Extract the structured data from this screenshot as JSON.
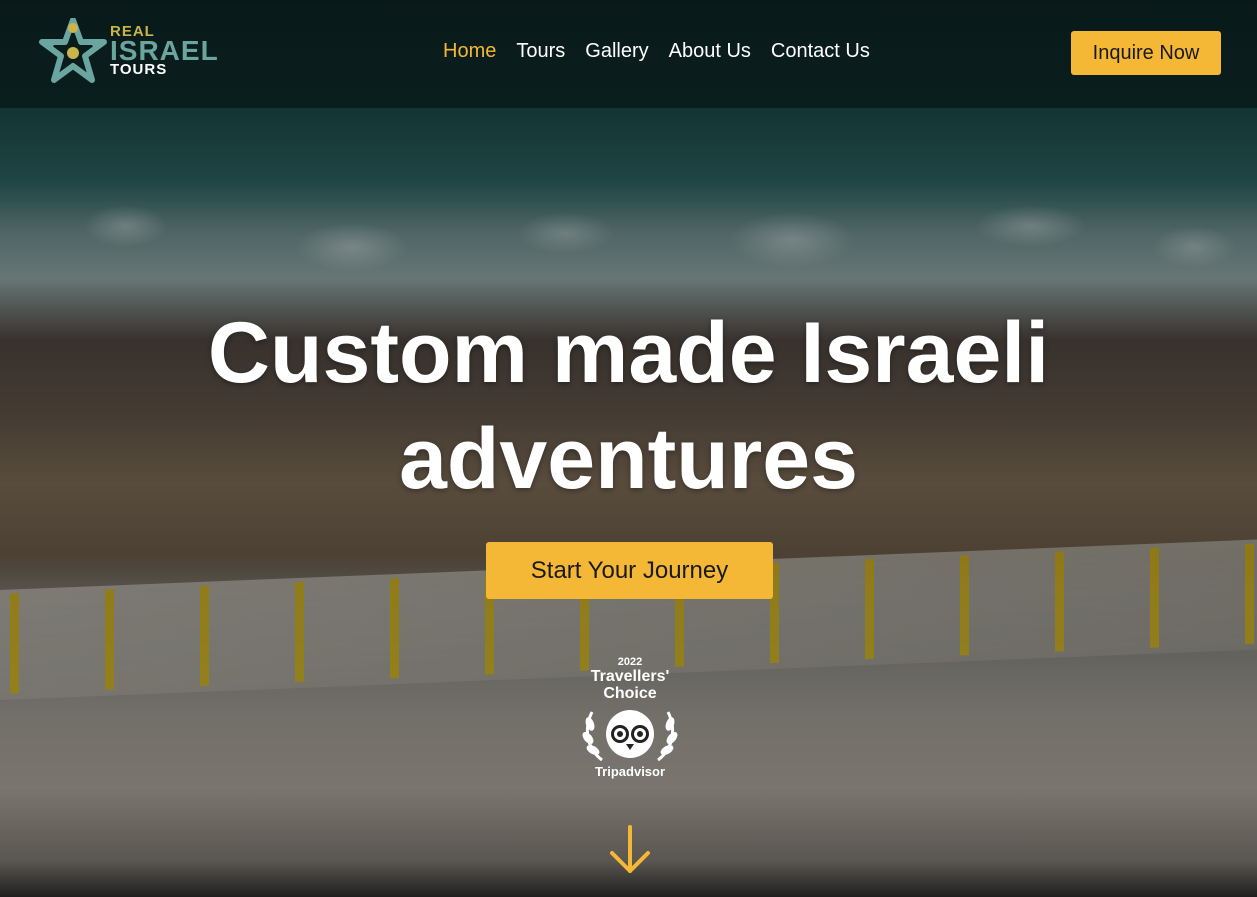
{
  "brand": {
    "logo_line1": "REAL",
    "logo_line2": "ISRAEL",
    "logo_line3": "TOURS"
  },
  "nav": {
    "items": [
      {
        "label": "Home",
        "active": true
      },
      {
        "label": "Tours"
      },
      {
        "label": "Gallery"
      },
      {
        "label": "About Us"
      },
      {
        "label": "Contact Us"
      }
    ]
  },
  "header": {
    "inquire_label": "Inquire Now"
  },
  "hero": {
    "headline_line1": "Custom made Israeli",
    "headline_line2": "adventures",
    "cta_label": "Start Your Journey"
  },
  "award": {
    "year": "2022",
    "title_line1": "Travellers'",
    "title_line2": "Choice",
    "brand": "Tripadvisor"
  },
  "icons": {
    "logo": "star-people-logo-icon",
    "award": "tripadvisor-owl-icon",
    "scroll": "arrow-down-icon"
  },
  "colors": {
    "accent": "#f5b836",
    "logo_gold": "#c9b54a",
    "logo_teal": "#6aa5a0"
  }
}
